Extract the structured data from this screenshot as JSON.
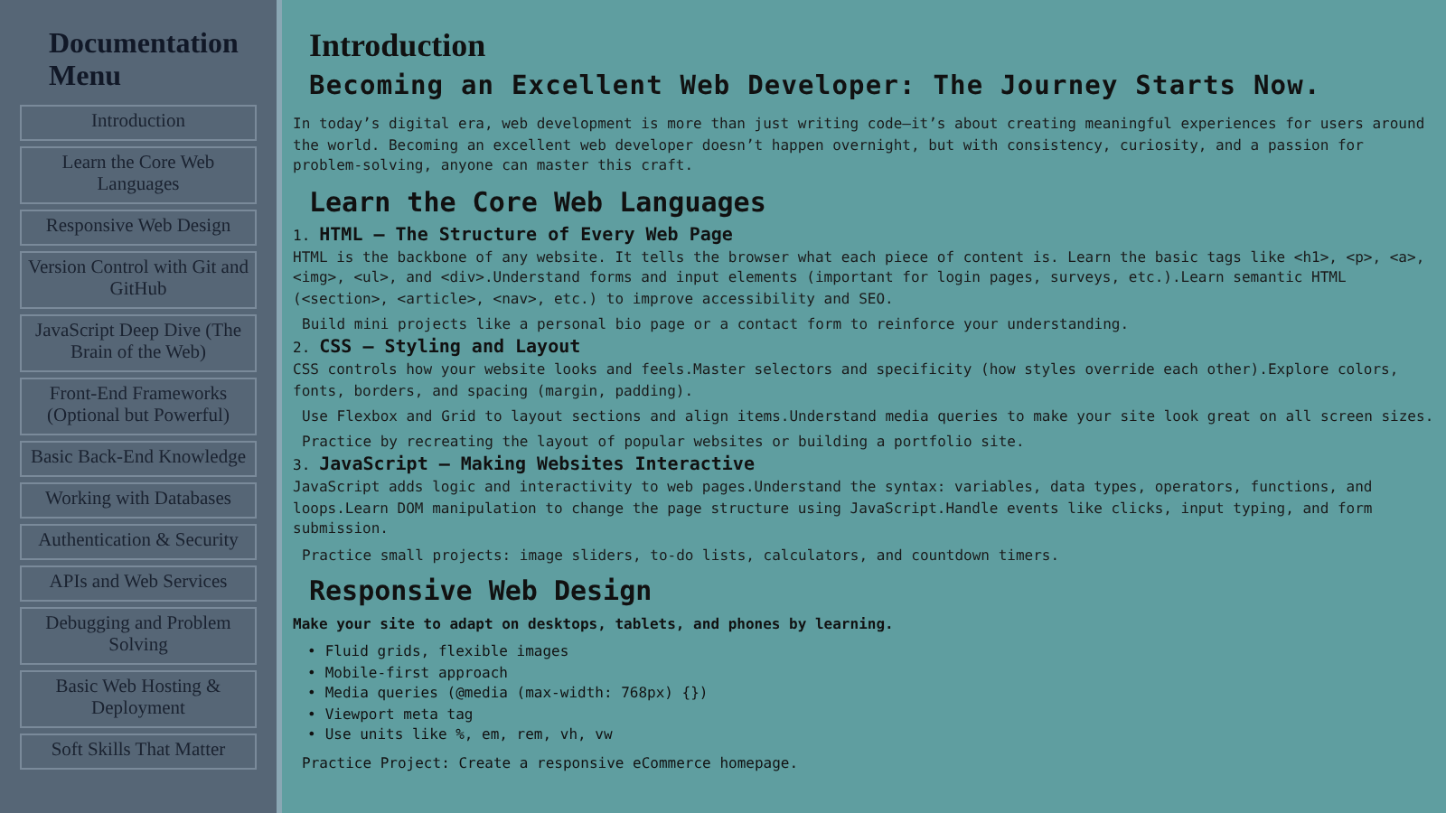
{
  "sidebar": {
    "title": "Documentation Menu",
    "items": [
      {
        "label": "Introduction"
      },
      {
        "label": "Learn the Core Web Languages"
      },
      {
        "label": "Responsive Web Design"
      },
      {
        "label": "Version Control with Git and GitHub"
      },
      {
        "label": "JavaScript Deep Dive (The Brain of the Web)"
      },
      {
        "label": "Front-End Frameworks (Optional but Powerful)"
      },
      {
        "label": "Basic Back-End Knowledge"
      },
      {
        "label": "Working with Databases"
      },
      {
        "label": "Authentication & Security"
      },
      {
        "label": "APIs and Web Services"
      },
      {
        "label": "Debugging and Problem Solving"
      },
      {
        "label": "Basic Web Hosting & Deployment"
      },
      {
        "label": "Soft Skills That Matter"
      }
    ]
  },
  "main": {
    "title": "Introduction",
    "subtitle": "Becoming an Excellent Web Developer: The Journey Starts Now.",
    "intro": "In today’s digital era, web development is more than just writing code—it’s about creating meaningful experiences for users around the world. Becoming an excellent web developer doesn’t happen overnight, but with consistency, curiosity, and a passion for problem-solving, anyone can master this craft.",
    "sections": [
      {
        "kind": "numbered",
        "heading": "Learn the Core Web Languages",
        "items": [
          {
            "number": "1.",
            "title": "HTML – The Structure of Every Web Page",
            "text": "HTML is the backbone of any website. It tells the browser what each piece of content is. Learn the basic tags like <h1>, <p>, <a>, <img>, <ul>, and <div>.Understand forms and input elements (important for login pages, surveys, etc.).Learn semantic HTML (<section>, <article>, <nav>, etc.) to improve accessibility and SEO.",
            "notes": [
              "Build mini projects like a personal bio page or a contact form to reinforce your understanding."
            ]
          },
          {
            "number": "2.",
            "title": "CSS – Styling and Layout",
            "text": "CSS controls how your website looks and feels.Master selectors and specificity (how styles override each other).Explore colors, fonts, borders, and spacing (margin, padding).",
            "notes": [
              "Use Flexbox and Grid to layout sections and align items.Understand media queries to make your site look great on all screen sizes.",
              "Practice by recreating the layout of popular websites or building a portfolio site."
            ]
          },
          {
            "number": "3.",
            "title": "JavaScript – Making Websites Interactive",
            "text": "JavaScript adds logic and interactivity to web pages.Understand the syntax: variables, data types, operators, functions, and loops.Learn DOM manipulation to change the page structure using JavaScript.Handle events like clicks, input typing, and form submission.",
            "notes": [
              "Practice small projects: image sliders, to-do lists, calculators, and countdown timers."
            ]
          }
        ]
      },
      {
        "kind": "bulleted",
        "heading": "Responsive Web Design",
        "lead": "Make your site to adapt on desktops, tablets, and phones by learning.",
        "bullets": [
          {
            "marker": "•",
            "text": "Fluid grids, flexible images"
          },
          {
            "marker": "•",
            "text": "Mobile-first approach"
          },
          {
            "marker": "•",
            "text": "Media queries (@media (max-width: 768px) {})"
          },
          {
            "marker": "•",
            "text": "Viewport meta tag"
          },
          {
            "marker": "•",
            "text": "Use units like %, em, rem, vh, vw"
          }
        ],
        "note": "Practice Project: Create a responsive eCommerce homepage."
      }
    ]
  }
}
